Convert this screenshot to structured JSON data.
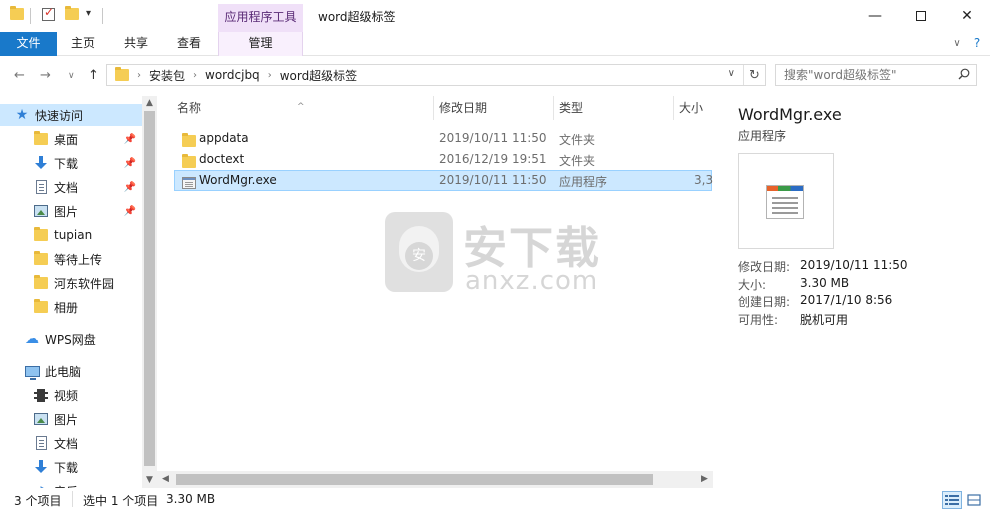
{
  "window": {
    "title": "word超级标签",
    "context_tab_header": "应用程序工具"
  },
  "ribbon": {
    "tabs": [
      "文件",
      "主页",
      "共享",
      "查看",
      "管理"
    ]
  },
  "address": {
    "crumbs": [
      "安装包",
      "wordcjbq",
      "word超级标签"
    ],
    "search_placeholder": "搜索\"word超级标签\""
  },
  "nav": {
    "quick_access": "快速访问",
    "items": [
      {
        "label": "桌面",
        "pinned": true
      },
      {
        "label": "下载",
        "pinned": true
      },
      {
        "label": "文档",
        "pinned": true
      },
      {
        "label": "图片",
        "pinned": true
      },
      {
        "label": "tupian",
        "pinned": false
      },
      {
        "label": "等待上传",
        "pinned": false
      },
      {
        "label": "河东软件园",
        "pinned": false
      },
      {
        "label": "相册",
        "pinned": false
      }
    ],
    "wps": "WPS网盘",
    "this_pc": "此电脑",
    "pc_items": [
      "视频",
      "图片",
      "文档",
      "下载",
      "音乐"
    ]
  },
  "columns": {
    "name": "名称",
    "date": "修改日期",
    "type": "类型",
    "size": "大小"
  },
  "files": [
    {
      "name": "appdata",
      "date": "2019/10/11 11:50",
      "type": "文件夹",
      "size": "",
      "kind": "folder"
    },
    {
      "name": "doctext",
      "date": "2016/12/19 19:51",
      "type": "文件夹",
      "size": "",
      "kind": "folder"
    },
    {
      "name": "WordMgr.exe",
      "date": "2019/10/11 11:50",
      "type": "应用程序",
      "size": "3,3",
      "kind": "exe"
    }
  ],
  "watermark": {
    "big": "安下载",
    "small": "anxz.com",
    "badge": "安"
  },
  "details": {
    "name": "WordMgr.exe",
    "type": "应用程序",
    "props": [
      {
        "label": "修改日期:",
        "value": "2019/10/11 11:50"
      },
      {
        "label": "大小:",
        "value": "3.30 MB"
      },
      {
        "label": "创建日期:",
        "value": "2017/1/10 8:56"
      },
      {
        "label": "可用性:",
        "value": "脱机可用"
      }
    ]
  },
  "status": {
    "count": "3 个项目",
    "selected": "选中 1 个项目",
    "size": "3.30 MB"
  },
  "colors": {
    "file_tab": "#1979ca",
    "selection": "#cce8ff",
    "context_tab": "#f0e0f8"
  }
}
